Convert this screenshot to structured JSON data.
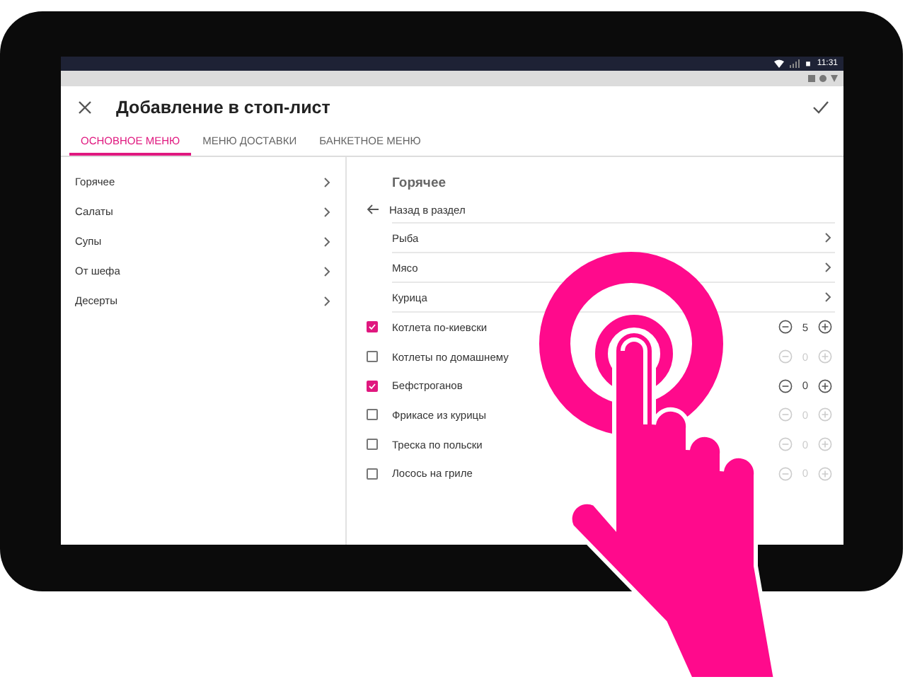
{
  "status_bar": {
    "time": "11:31"
  },
  "app_bar": {
    "title": "Добавление в стоп-лист"
  },
  "tabs": [
    {
      "label": "ОСНОВНОЕ МЕНЮ",
      "selected": true
    },
    {
      "label": "МЕНЮ ДОСТАВКИ",
      "selected": false
    },
    {
      "label": "БАНКЕТНОЕ МЕНЮ",
      "selected": false
    }
  ],
  "categories": [
    "Горячее",
    "Салаты",
    "Супы",
    "От шефа",
    "Десерты"
  ],
  "section": {
    "title": "Горячее",
    "back_link": "Назад в раздел",
    "subcategories": [
      "Рыба",
      "Мясо",
      "Курица"
    ],
    "dishes": [
      {
        "name": "Котлета по-киевски",
        "checked": true,
        "quantity": "5"
      },
      {
        "name": "Котлеты по домашнему",
        "checked": false,
        "quantity": "0"
      },
      {
        "name": "Бефстроганов",
        "checked": true,
        "quantity": "0"
      },
      {
        "name": "Фрикасе из курицы",
        "checked": false,
        "quantity": "0"
      },
      {
        "name": "Треска по польски",
        "checked": false,
        "quantity": "0"
      },
      {
        "name": "Лосось на гриле",
        "checked": false,
        "quantity": "0"
      }
    ]
  }
}
